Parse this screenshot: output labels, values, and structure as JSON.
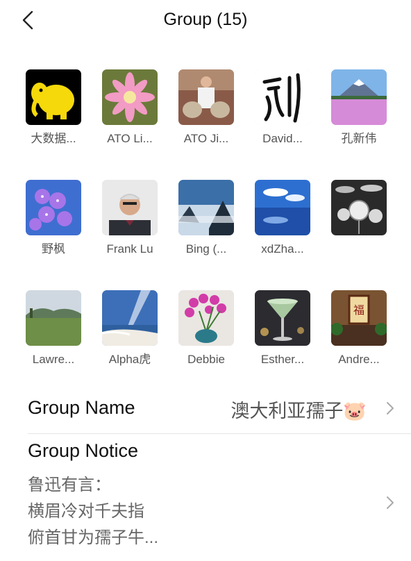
{
  "header": {
    "title": "Group (15)"
  },
  "members": [
    {
      "name": "大数据...",
      "avatar": "hadoop-elephant"
    },
    {
      "name": "ATO Li...",
      "avatar": "pink-flower"
    },
    {
      "name": "ATO Ji...",
      "avatar": "man-holding-pumpkins"
    },
    {
      "name": "David...",
      "avatar": "calligraphy-liu"
    },
    {
      "name": "孔新伟",
      "avatar": "mount-fuji-lavender"
    },
    {
      "name": "野枫",
      "avatar": "purple-flowers"
    },
    {
      "name": "Frank Lu",
      "avatar": "man-portrait"
    },
    {
      "name": "Bing (...",
      "avatar": "misty-mountains"
    },
    {
      "name": "xdZha...",
      "avatar": "sky-reflection-lake"
    },
    {
      "name": "",
      "avatar": "drum-kit"
    },
    {
      "name": "Lawre...",
      "avatar": "green-meadow"
    },
    {
      "name": "Alpha虎",
      "avatar": "beach-sunbeam"
    },
    {
      "name": "Debbie",
      "avatar": "pink-orchid"
    },
    {
      "name": "Esther...",
      "avatar": "green-cocktail"
    },
    {
      "name": "Andre...",
      "avatar": "chinese-plaque"
    }
  ],
  "group_name": {
    "label": "Group Name",
    "value": "澳大利亚孺子🐷"
  },
  "group_notice": {
    "label": "Group Notice",
    "lines": [
      "鲁迅有言：",
      "横眉冷对千夫指",
      "俯首甘为孺子牛..."
    ]
  }
}
